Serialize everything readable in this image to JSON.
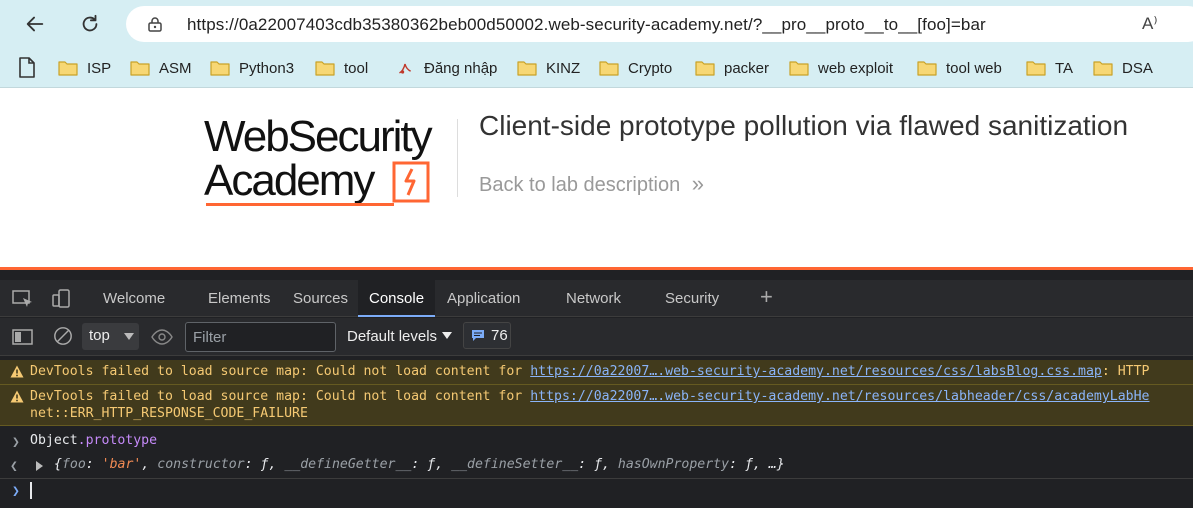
{
  "browser": {
    "url": "https://0a22007403cdb35380362beb00d50002.web-security-academy.net/?__pro__proto__to__[foo]=bar",
    "read_aloud_label": "A⁾"
  },
  "bookmarks": [
    {
      "label": "ISP",
      "icon": "folder-icon"
    },
    {
      "label": "ASM",
      "icon": "folder-icon"
    },
    {
      "label": "Python3",
      "icon": "folder-icon"
    },
    {
      "label": "tool",
      "icon": "folder-icon"
    },
    {
      "label": "Đăng nhập",
      "icon": "site-icon"
    },
    {
      "label": "KINZ",
      "icon": "folder-icon"
    },
    {
      "label": "Crypto",
      "icon": "folder-icon"
    },
    {
      "label": "packer",
      "icon": "folder-icon"
    },
    {
      "label": "web exploit",
      "icon": "folder-icon"
    },
    {
      "label": "tool web",
      "icon": "folder-icon"
    },
    {
      "label": "TA",
      "icon": "folder-icon"
    },
    {
      "label": "DSA",
      "icon": "folder-icon"
    }
  ],
  "page": {
    "logo_line1": "WebSecurity",
    "logo_line2": "Academy",
    "title": "Client-side prototype pollution via flawed sanitization",
    "back_link": "Back to lab description",
    "back_chevrons": "»",
    "brand_color": "#ff6633"
  },
  "devtools": {
    "tabs": [
      "Welcome",
      "Elements",
      "Sources",
      "Console",
      "Application",
      "Network",
      "Security"
    ],
    "active_tab": "Console",
    "context": "top",
    "filter_placeholder": "Filter",
    "levels": "Default levels",
    "message_count": "76",
    "warnings": [
      {
        "prefix": "DevTools failed to load source map: Could not load content for ",
        "link": "https://0a22007….web-security-academy.net/resources/css/labsBlog.css.map",
        "suffix": ": HTTP"
      },
      {
        "prefix": "DevTools failed to load source map: Could not load content for ",
        "link": "https://0a22007….web-security-academy.net/resources/labheader/css/academyLabHe",
        "suffix": "",
        "line2": "net::ERR_HTTP_RESPONSE_CODE_FAILURE"
      }
    ],
    "input_expr_obj": "Object",
    "input_expr_prop": ".prototype",
    "result": {
      "open": "{",
      "k1": "foo",
      "v1": "'bar'",
      "k2": "constructor",
      "v2": "ƒ",
      "k3": "__defineGetter__",
      "v3": "ƒ",
      "k4": "__defineSetter__",
      "v4": "ƒ",
      "k5": "hasOwnProperty",
      "v5": "ƒ",
      "close": "…}"
    }
  }
}
